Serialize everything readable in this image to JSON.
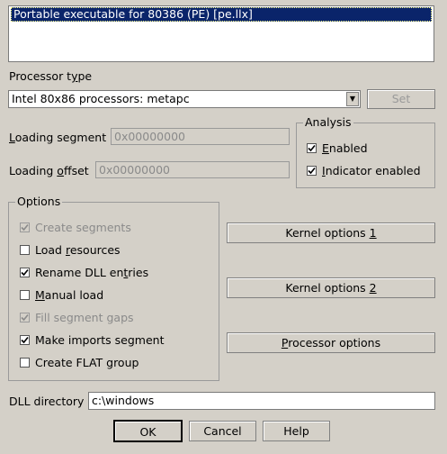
{
  "loader_list": {
    "selected_item": "Portable executable for 80386 (PE) [pe.llx]"
  },
  "processor": {
    "label": "Processor type",
    "label_accel": "y",
    "selected": "Intel 80x86 processors: metapc",
    "set_button": "Set"
  },
  "loading": {
    "segment_label": "Loading segment",
    "segment_value": "0x00000000",
    "offset_label": "Loading offset",
    "offset_value": "0x00000000"
  },
  "analysis": {
    "title": "Analysis",
    "enabled_label": "Enabled",
    "indicator_label": "Indicator enabled"
  },
  "options": {
    "title": "Options",
    "items": [
      {
        "label": "Create segments",
        "checked": true,
        "enabled": false
      },
      {
        "label": "Load resources",
        "checked": false,
        "enabled": true
      },
      {
        "label": "Rename DLL entries",
        "checked": true,
        "enabled": true
      },
      {
        "label": "Manual load",
        "checked": false,
        "enabled": true
      },
      {
        "label": "Fill segment gaps",
        "checked": true,
        "enabled": false
      },
      {
        "label": "Make imports segment",
        "checked": true,
        "enabled": true
      },
      {
        "label": "Create FLAT group",
        "checked": false,
        "enabled": true
      }
    ]
  },
  "buttons": {
    "kernel1": "Kernel options 1",
    "kernel2": "Kernel options 2",
    "processor_options": "Processor options",
    "ok": "OK",
    "cancel": "Cancel",
    "help": "Help"
  },
  "dll": {
    "label": "DLL directory",
    "value": "c:\\windows"
  }
}
